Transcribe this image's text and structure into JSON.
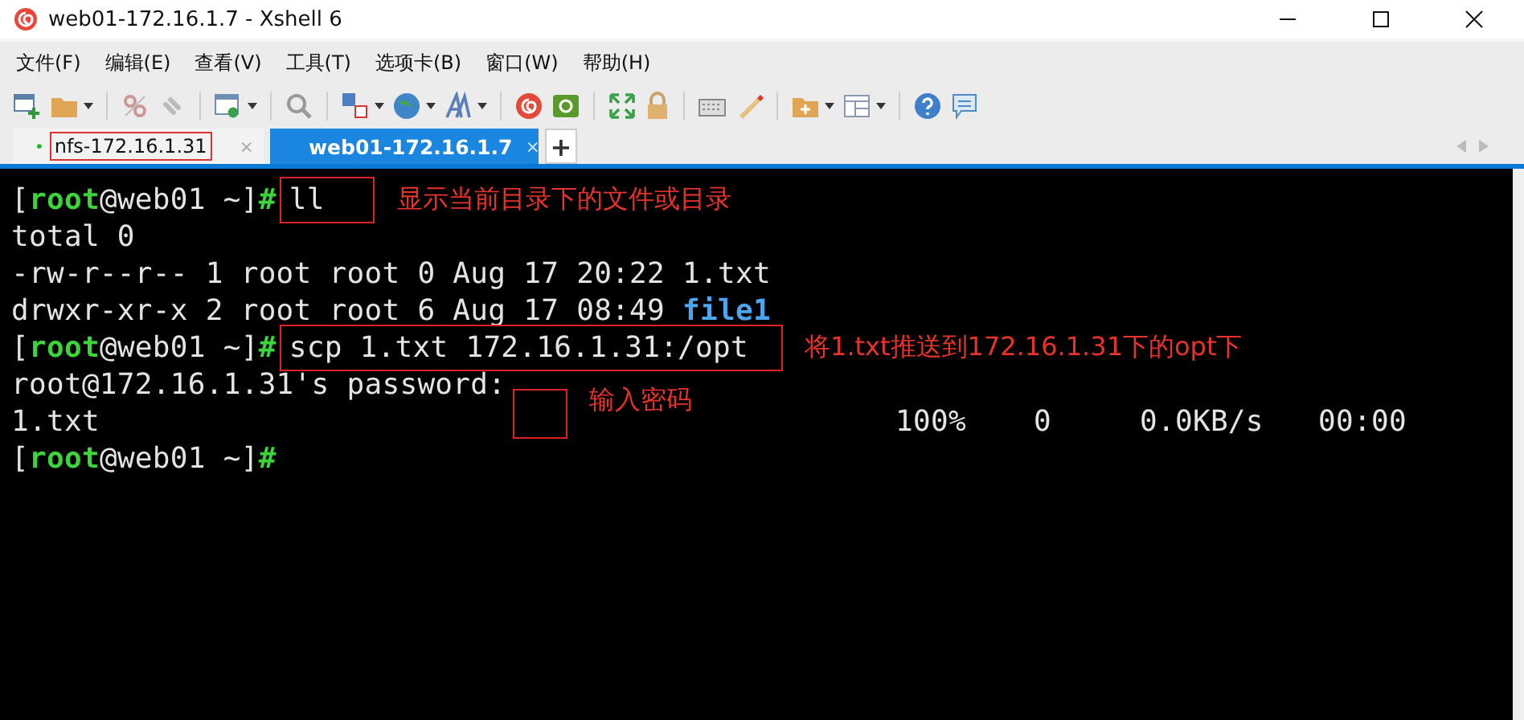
{
  "window": {
    "title": "web01-172.16.1.7 - Xshell 6"
  },
  "menu": [
    "文件(F)",
    "编辑(E)",
    "查看(V)",
    "工具(T)",
    "选项卡(B)",
    "窗口(W)",
    "帮助(H)"
  ],
  "tabs": [
    {
      "label": "nfs-172.16.1.31",
      "selected": false,
      "annotated": true,
      "close": "×"
    },
    {
      "label": "web01-172.16.1.7",
      "selected": true,
      "annotated": false,
      "close": "×"
    }
  ],
  "new_tab": "+",
  "terminal": {
    "lines": [
      {
        "kind": "prompt",
        "segments": [
          {
            "kind": "plain",
            "text": "["
          },
          {
            "kind": "user",
            "text": "root"
          },
          {
            "kind": "plain",
            "text": "@web01 ~]"
          },
          {
            "kind": "sign",
            "text": "#"
          }
        ],
        "command": "ll",
        "note": "显示当前目录下的文件或目录"
      },
      {
        "kind": "output",
        "segments": [
          {
            "kind": "plain",
            "text": "total 0"
          }
        ]
      },
      {
        "kind": "output",
        "segments": [
          {
            "kind": "plain",
            "text": "-rw-r--r-- 1 root root 0 Aug 17 20:22 1.txt"
          }
        ]
      },
      {
        "kind": "output",
        "segments": [
          {
            "kind": "plain",
            "text": "drwxr-xr-x 2 root root 6 Aug 17 08:49 "
          },
          {
            "kind": "dir",
            "text": "file1"
          }
        ]
      },
      {
        "kind": "prompt",
        "segments": [
          {
            "kind": "plain",
            "text": "["
          },
          {
            "kind": "user",
            "text": "root"
          },
          {
            "kind": "plain",
            "text": "@web01 ~]"
          },
          {
            "kind": "sign",
            "text": "#"
          }
        ],
        "command": "scp 1.txt 172.16.1.31:/opt",
        "note": "将1.txt推送到172.16.1.31下的opt下"
      },
      {
        "kind": "password",
        "segments": [
          {
            "kind": "plain",
            "text": "root@172.16.1.31's password:"
          }
        ],
        "note": "输入密码"
      },
      {
        "kind": "progress",
        "file": "1.txt",
        "columns": [
          "100%",
          "0",
          "0.0KB/s",
          "00:00"
        ]
      },
      {
        "kind": "prompt",
        "segments": [
          {
            "kind": "plain",
            "text": "["
          },
          {
            "kind": "user",
            "text": "root"
          },
          {
            "kind": "plain",
            "text": "@web01 ~]"
          },
          {
            "kind": "sign",
            "text": "#"
          }
        ]
      }
    ]
  }
}
